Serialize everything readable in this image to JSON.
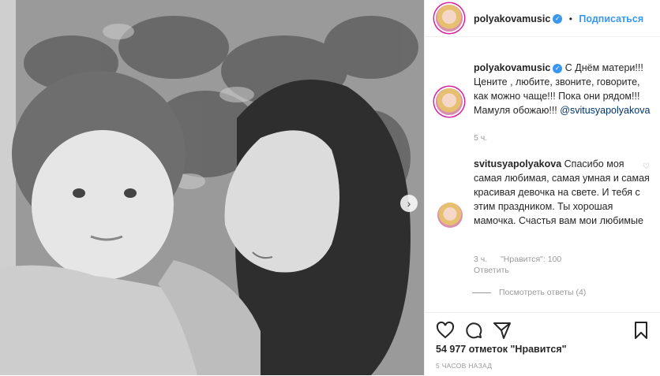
{
  "post": {
    "author": "polyakovamusic",
    "follow_label": "Подписаться",
    "separator": "•"
  },
  "caption": {
    "author": "polyakovamusic",
    "text": "С Днём матери!!! Цените , любите, звоните, говорите, как можно чаще!!! Пока они рядом!!! Мамуля обожаю!!!",
    "mention": "@svitusyapolyakova",
    "time": "5 ч."
  },
  "comment": {
    "author": "svitusyapolyakova",
    "text": "Спасибо моя самая любимая, самая умная и самая красивая девочка на свете. И тебя с этим праздником. Ты хорошая мамочка. Счастья вам мои любимые",
    "time": "3 ч.",
    "likes": "\"Нравится\": 100",
    "reply_label": "Ответить",
    "view_replies": "Посмотреть ответы (4)"
  },
  "footer": {
    "likes": "54 977 отметок \"Нравится\"",
    "time_ago": "5 ЧАСОВ НАЗАД"
  },
  "icons": {
    "like": "heart-icon",
    "comment": "comment-icon",
    "share": "share-icon",
    "save": "bookmark-icon",
    "next": "chevron-right-icon"
  },
  "colors": {
    "link": "#3897f0",
    "verified": "#3897f0",
    "story_ring": "#d6249f"
  }
}
